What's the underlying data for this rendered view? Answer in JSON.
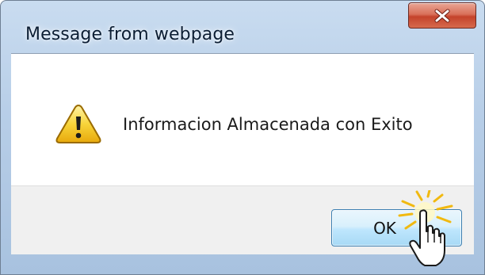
{
  "dialog": {
    "title": "Message from webpage",
    "message": "Informacion Almacenada con Exito",
    "ok_label": "OK",
    "close_symbol": "x",
    "icon": "warning-icon"
  },
  "colors": {
    "frame": "#b6cde7",
    "close_button": "#c4432b",
    "ok_button": "#bee6fd",
    "footer": "#f0f0f0",
    "warning_yellow": "#f4c21c"
  },
  "cursor": {
    "icon": "hand-pointer-icon",
    "effect": "click-burst"
  }
}
